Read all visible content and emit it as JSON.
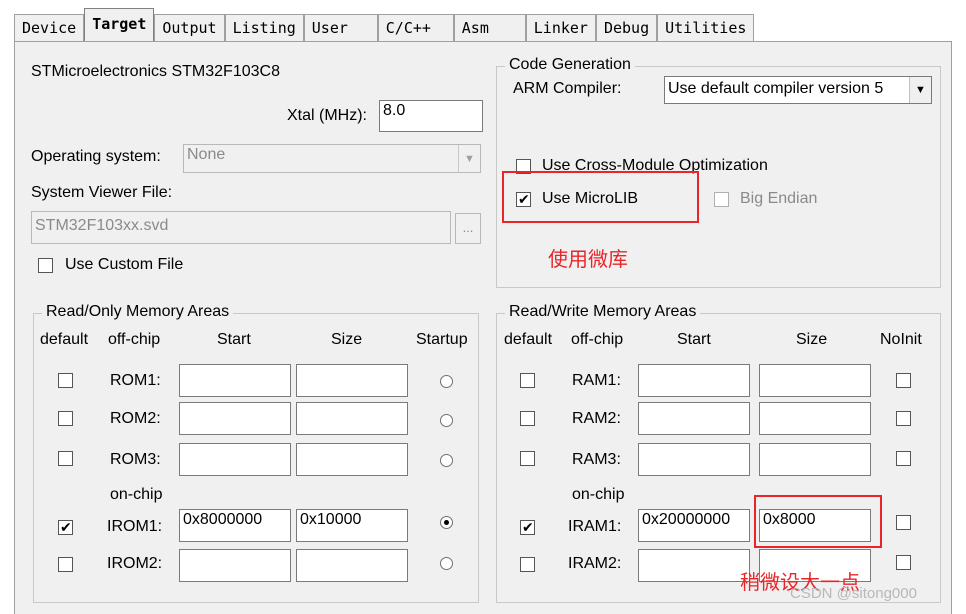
{
  "tabs": [
    {
      "label": "Device"
    },
    {
      "label": "Target"
    },
    {
      "label": "Output"
    },
    {
      "label": "Listing"
    },
    {
      "label": "User"
    },
    {
      "label": "C/C++"
    },
    {
      "label": "Asm"
    },
    {
      "label": "Linker"
    },
    {
      "label": "Debug"
    },
    {
      "label": "Utilities"
    }
  ],
  "active_tab": "Target",
  "device_name": "STMicroelectronics STM32F103C8",
  "xtal": {
    "label": "Xtal (MHz):",
    "value": "8.0"
  },
  "os": {
    "label": "Operating system:",
    "value": "None"
  },
  "svd": {
    "label": "System Viewer File:",
    "value": "STM32F103xx.svd",
    "browse": "..."
  },
  "custom_file": {
    "label": "Use Custom File",
    "checked": false
  },
  "code_gen": {
    "legend": "Code Generation",
    "compiler_label": "ARM Compiler:",
    "compiler_value": "Use default compiler version 5",
    "cross_module": {
      "label": "Use Cross-Module Optimization",
      "checked": false
    },
    "microlib": {
      "label": "Use MicroLIB",
      "checked": true
    },
    "big_endian": {
      "label": "Big Endian",
      "checked": false
    }
  },
  "ro_mem": {
    "legend": "Read/Only Memory Areas",
    "headers": {
      "default": "default",
      "offchip": "off-chip",
      "start": "Start",
      "size": "Size",
      "extra": "Startup"
    },
    "onchip_label": "on-chip",
    "rows": [
      {
        "name": "ROM1:",
        "start": "",
        "size": "",
        "default": false,
        "startup": false
      },
      {
        "name": "ROM2:",
        "start": "",
        "size": "",
        "default": false,
        "startup": false
      },
      {
        "name": "ROM3:",
        "start": "",
        "size": "",
        "default": false,
        "startup": false
      },
      {
        "name": "IROM1:",
        "start": "0x8000000",
        "size": "0x10000",
        "default": true,
        "startup": true
      },
      {
        "name": "IROM2:",
        "start": "",
        "size": "",
        "default": false,
        "startup": false
      }
    ]
  },
  "rw_mem": {
    "legend": "Read/Write Memory Areas",
    "headers": {
      "default": "default",
      "offchip": "off-chip",
      "start": "Start",
      "size": "Size",
      "extra": "NoInit"
    },
    "onchip_label": "on-chip",
    "rows": [
      {
        "name": "RAM1:",
        "start": "",
        "size": "",
        "default": false,
        "noinit": false
      },
      {
        "name": "RAM2:",
        "start": "",
        "size": "",
        "default": false,
        "noinit": false
      },
      {
        "name": "RAM3:",
        "start": "",
        "size": "",
        "default": false,
        "noinit": false
      },
      {
        "name": "IRAM1:",
        "start": "0x20000000",
        "size": "0x8000",
        "default": true,
        "noinit": false
      },
      {
        "name": "IRAM2:",
        "start": "",
        "size": "",
        "default": false,
        "noinit": false
      }
    ]
  },
  "annotations": {
    "microlib_note": "使用微库",
    "iram_note": "稍微设大一点"
  },
  "watermark": "CSDN @sitong000",
  "colors": {
    "annotation_red": "#e8262a",
    "panel_bg": "#f0f0f0"
  }
}
